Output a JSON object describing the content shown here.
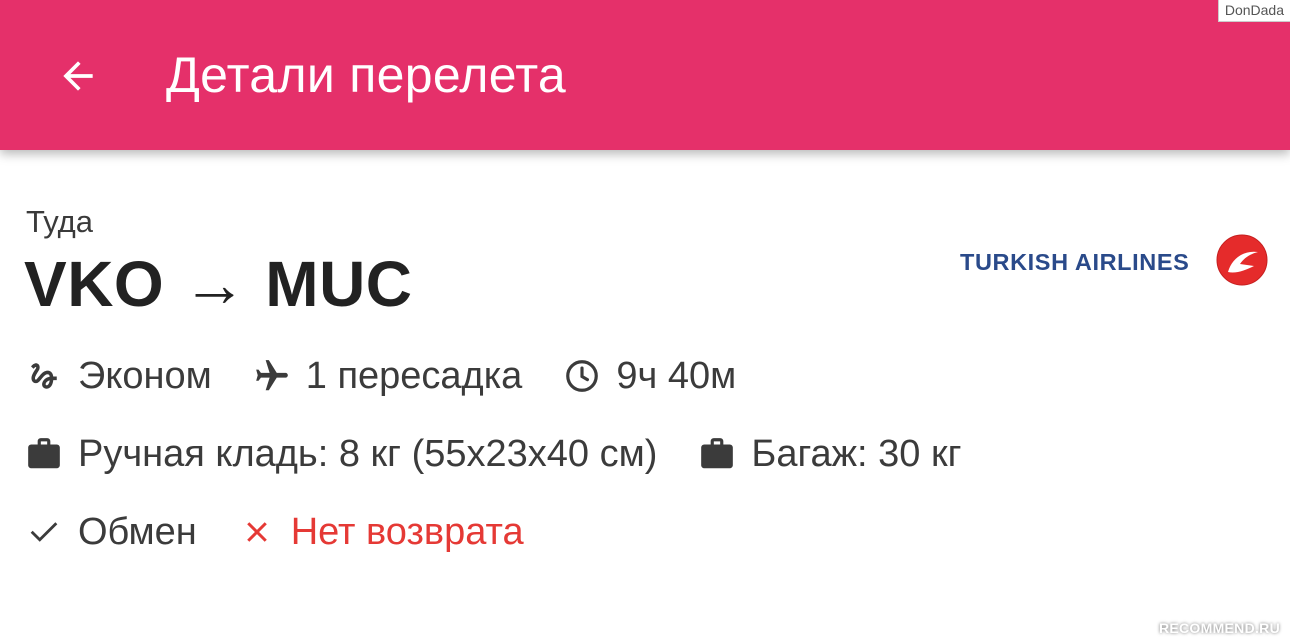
{
  "watermark_top": "DonDada",
  "header": {
    "title": "Детали перелета",
    "back_icon": "arrow-back-icon",
    "color": "#e5306a"
  },
  "flight": {
    "direction_label": "Туда",
    "route": "VKO → MUC",
    "airline": {
      "name": "TURKISH AIRLINES",
      "brand_color": "#2a4a8a",
      "logo_color": "#e52b2b"
    }
  },
  "details": {
    "cabin": {
      "icon": "seat-icon",
      "label": "Эконом"
    },
    "stops": {
      "icon": "airplane-icon",
      "label": "1 пересадка"
    },
    "duration": {
      "icon": "clock-icon",
      "label": "9ч 40м"
    },
    "hand_luggage": {
      "icon": "briefcase-icon",
      "label": "Ручная кладь: 8 кг (55x23x40 см)"
    },
    "baggage": {
      "icon": "briefcase-icon",
      "label": "Багаж: 30 кг"
    },
    "exchange": {
      "icon": "check-icon",
      "label": "Обмен"
    },
    "refund": {
      "icon": "cross-icon",
      "label": "Нет возврата",
      "color": "#e53935"
    }
  },
  "watermark_bottom": "RECOMMEND.RU"
}
